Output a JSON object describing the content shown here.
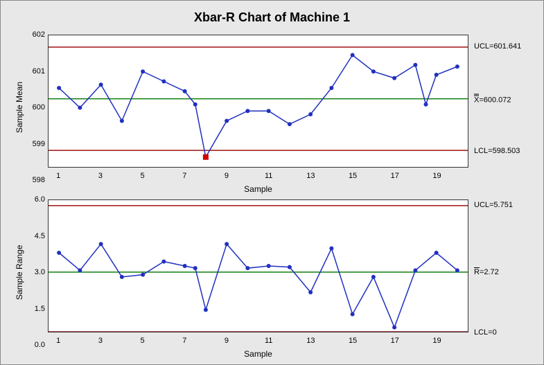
{
  "title": "Xbar-R Chart of Machine 1",
  "panels": {
    "xbar": {
      "xlabel": "Sample",
      "ylabel": "Sample Mean",
      "limits": {
        "ucl": {
          "label": "UCL=601.641"
        },
        "cl": {
          "label_prefix": "X",
          "label_suffix": "=600.072"
        },
        "lcl": {
          "label": "LCL=598.503"
        }
      }
    },
    "r": {
      "xlabel": "Sample",
      "ylabel": "Sample Range",
      "limits": {
        "ucl": {
          "label": "UCL=5.751"
        },
        "cl": {
          "label_prefix": "R",
          "label_suffix": "=2.72"
        },
        "lcl": {
          "label": "LCL=0"
        }
      }
    }
  },
  "chart_data": [
    {
      "type": "line",
      "name": "xbar",
      "title": "Xbar-R Chart of Machine 1",
      "xlabel": "Sample",
      "ylabel": "Sample Mean",
      "x": [
        1,
        2,
        3,
        4,
        5,
        6,
        7,
        8,
        9,
        10,
        11,
        12,
        13,
        14,
        15,
        16,
        17,
        18,
        19,
        20
      ],
      "values": [
        600.4,
        599.8,
        600.5,
        599.4,
        600.9,
        600.6,
        600.3,
        599.9,
        598.3,
        599.4,
        599.7,
        599.7,
        599.3,
        599.6,
        600.4,
        601.4,
        600.9,
        600.7,
        601.1,
        599.9,
        600.8,
        601.05
      ],
      "x_plot": [
        1,
        2,
        3,
        4,
        5,
        6,
        7,
        7.5,
        8,
        9,
        10,
        11,
        12,
        13,
        14,
        15,
        16,
        17,
        18,
        18.5,
        19,
        20
      ],
      "ucl": 601.641,
      "cl": 600.072,
      "lcl": 598.503,
      "ylim": [
        598,
        602
      ],
      "yticks": [
        598,
        599,
        600,
        601,
        602
      ],
      "xticks": [
        1,
        3,
        5,
        7,
        9,
        11,
        13,
        15,
        17,
        19
      ],
      "out_of_control_x": [
        8
      ],
      "annotations": [
        "UCL=601.641",
        "X̄̄=600.072",
        "LCL=598.503"
      ]
    },
    {
      "type": "line",
      "name": "r",
      "xlabel": "Sample",
      "ylabel": "Sample Range",
      "x": [
        1,
        2,
        3,
        4,
        5,
        6,
        7,
        8,
        9,
        10,
        11,
        12,
        13,
        14,
        15,
        16,
        17,
        18,
        19,
        20
      ],
      "values": [
        3.6,
        2.8,
        4.0,
        2.5,
        2.6,
        3.2,
        3.0,
        2.9,
        1.0,
        4.0,
        2.9,
        3.0,
        2.95,
        1.8,
        3.8,
        0.8,
        2.5,
        0.2,
        2.8,
        3.6,
        2.8
      ],
      "x_plot": [
        1,
        2,
        3,
        4,
        5,
        6,
        7,
        7.5,
        8,
        9,
        10,
        11,
        12,
        13,
        14,
        15,
        16,
        17,
        18,
        19,
        20
      ],
      "ucl": 5.751,
      "cl": 2.72,
      "lcl": 0,
      "ylim": [
        0.0,
        6.0
      ],
      "yticks": [
        0.0,
        1.5,
        3.0,
        4.5,
        6.0
      ],
      "xticks": [
        1,
        3,
        5,
        7,
        9,
        11,
        13,
        15,
        17,
        19
      ],
      "annotations": [
        "UCL=5.751",
        "R̄=2.72",
        "LCL=0"
      ]
    }
  ]
}
